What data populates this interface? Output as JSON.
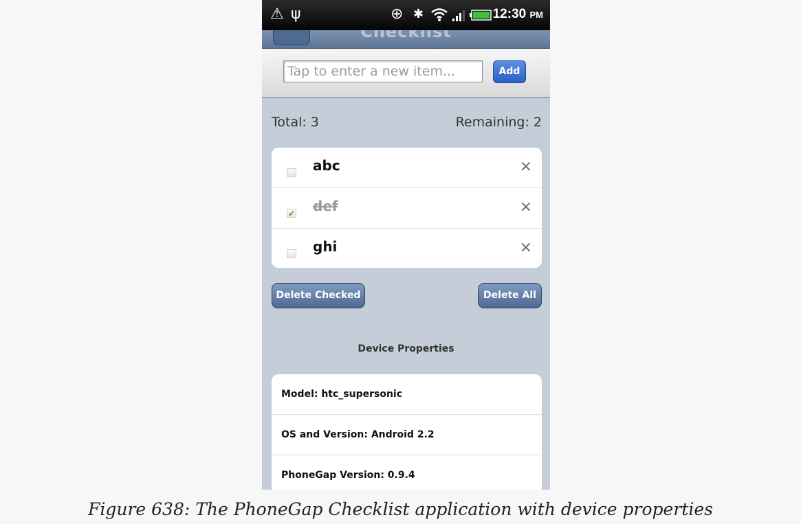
{
  "status_bar": {
    "icons": [
      "warning-icon",
      "usb-icon",
      "gps-icon",
      "bluetooth-icon",
      "wifi-icon",
      "signal-icon",
      "battery-icon"
    ],
    "time": "12:30",
    "ampm": "PM"
  },
  "app": {
    "title": "Checklist",
    "new_item_placeholder": "Tap to enter a new item...",
    "add_label": "Add",
    "total_text": "Total: 3",
    "remaining_text": "Remaining: 2",
    "items": [
      {
        "label": "abc",
        "checked": false
      },
      {
        "label": "def",
        "checked": true
      },
      {
        "label": "ghi",
        "checked": false
      }
    ],
    "delete_glyph": "×",
    "delete_checked_label": "Delete Checked",
    "delete_all_label": "Delete All",
    "device_section_title": "Device Properties",
    "device_props": [
      "Model: htc_supersonic",
      "OS and Version: Android 2.2",
      "PhoneGap Version: 0.9.4"
    ]
  },
  "caption": "Figure 638: The PhoneGap Checklist application with device properties",
  "colors": {
    "page_bg": "#c5cdd8",
    "title_bar": "#6b82a3",
    "add_button": "#2a61c4",
    "action_button": "#5f7ba2",
    "check_green": "#4aa52a"
  }
}
